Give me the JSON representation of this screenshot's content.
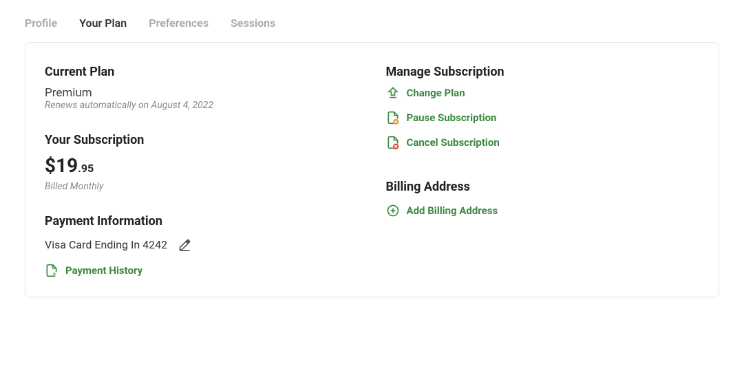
{
  "tabs": [
    "Profile",
    "Your Plan",
    "Preferences",
    "Sessions"
  ],
  "activeTab": 1,
  "currentPlan": {
    "heading": "Current Plan",
    "name": "Premium",
    "renewal": "Renews automatically on August 4, 2022"
  },
  "subscription": {
    "heading": "Your Subscription",
    "priceWhole": "$19",
    "priceCents": ".95",
    "billingCycle": "Billed Monthly"
  },
  "payment": {
    "heading": "Payment Information",
    "card": "Visa Card Ending In 4242",
    "historyLabel": "Payment History"
  },
  "manage": {
    "heading": "Manage Subscription",
    "changePlan": "Change Plan",
    "pause": "Pause Subscription",
    "cancel": "Cancel Subscription"
  },
  "billing": {
    "heading": "Billing Address",
    "addLabel": "Add Billing Address"
  }
}
